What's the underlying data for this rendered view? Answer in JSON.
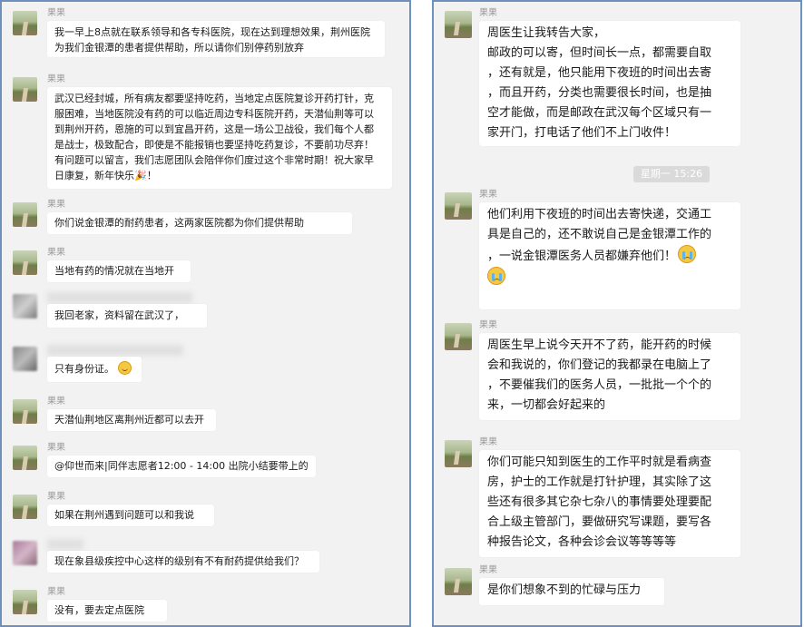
{
  "left_chat": {
    "messages": [
      {
        "sender": "果果",
        "text": "我一早上8点就在联系领导和各专科医院，现在达到理想效果，荆州医院\n为我们金银潭的患者提供帮助，所以请你们别停药别放弃"
      },
      {
        "sender": "果果",
        "text": "武汉已经封城，所有病友都要坚持吃药，当地定点医院复诊开药打针，克\n服困难，当地医院没有药的可以临近周边专科医院开药，天潜仙荆等可以\n到荆州开药，恩施的可以到宜昌开药，这是一场公卫战役，我们每个人都\n是战士，极致配合，即使是不能报销也要坚持吃药复诊，不要前功尽弃！\n有问题可以留言，我们志愿团队会陪伴你们度过这个非常时期！祝大家早\n日康复，新年快乐",
        "emoji": "🎉",
        "tail": "！"
      },
      {
        "sender": "果果",
        "text": "你们说金银潭的耐药患者，这两家医院都为你们提供帮助"
      },
      {
        "sender": "果果",
        "text": "当地有药的情况就在当地开"
      },
      {
        "sender": "",
        "text": "我回老家，资料留在武汉了，"
      },
      {
        "sender": "",
        "text": "只有身份证。"
      },
      {
        "sender": "果果",
        "text": "天潜仙荆地区离荆州近都可以去开"
      },
      {
        "sender": "果果",
        "text": "@仰世而来|同伴志愿者12:00 - 14:00 出院小结要带上的"
      },
      {
        "sender": "果果",
        "text": "如果在荆州遇到问题可以和我说"
      },
      {
        "sender": "",
        "text": "现在象县级疾控中心这样的级别有不有耐药提供给我们？"
      },
      {
        "sender": "果果",
        "text": "没有，要去定点医院"
      }
    ]
  },
  "right_chat": {
    "time_separator": "星期一 15:26",
    "messages": [
      {
        "sender": "果果",
        "text": "周医生让我转告大家，\n邮政的可以寄，但时间长一点，都需要自取\n，还有就是，他只能用下夜班的时间出去寄\n，而且开药，分类也需要很长时间，也是抽\n空才能做，而是邮政在武汉每个区域只有一\n家开门，打电话了他们不上门收件！"
      },
      {
        "sender": "果果",
        "text": "他们利用下夜班的时间出去寄快递，交通工\n具是自己的，还不敢说自己是金银潭工作的\n，一说金银潭医务人员都嫌弃他们！"
      },
      {
        "sender": "果果",
        "text": "周医生早上说今天开不了药，能开药的时候\n会和我说的，你们登记的我都录在电脑上了\n，不要催我们的医务人员，一批批一个个的\n来，一切都会好起来的"
      },
      {
        "sender": "果果",
        "text": "你们可能只知到医生的工作平时就是看病查\n房，护士的工作就是打针护理，其实除了这\n些还有很多其它杂七杂八的事情要处理要配\n合上级主管部门，要做研究写课题，要写各\n种报告论文，各种会诊会议等等等等"
      },
      {
        "sender": "果果",
        "text": "是你们想象不到的忙碌与压力"
      }
    ]
  }
}
